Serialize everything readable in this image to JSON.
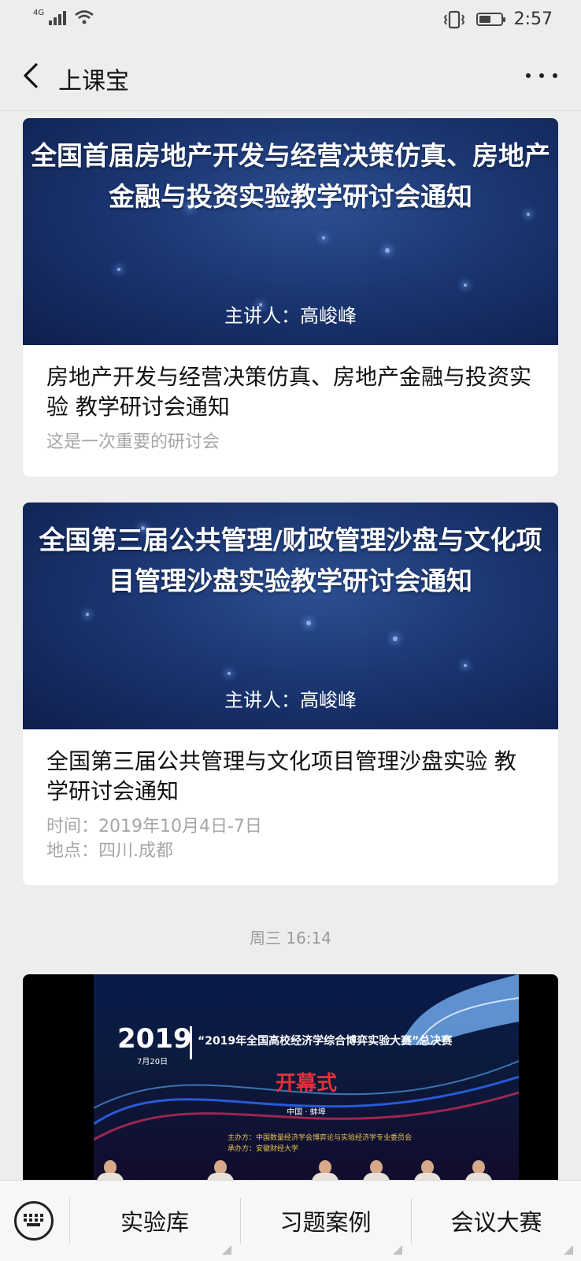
{
  "status_bar": {
    "network": "4G",
    "time": "2:57",
    "battery_level": 0.55
  },
  "nav": {
    "title": "上课宝"
  },
  "cards": [
    {
      "banner_title": "全国首届房地产开发与经营决策仿真、房地产金融与投资实验教学研讨会通知",
      "speaker": "主讲人：高峻峰",
      "title": "房地产开发与经营决策仿真、房地产金融与投资实验 教学研讨会通知",
      "desc_lines": [
        "这是一次重要的研讨会"
      ]
    },
    {
      "banner_title": "全国第三届公共管理/财政管理沙盘与文化项目管理沙盘实验教学研讨会通知",
      "speaker": "主讲人：高峻峰",
      "title": "全国第三届公共管理与文化项目管理沙盘实验 教学研讨会通知",
      "desc_lines": [
        "时间：2019年10月4日-7日",
        "地点：四川.成都"
      ]
    }
  ],
  "timestamp": "周三 16:14",
  "photo": {
    "year": "2019",
    "date": "7月20日",
    "headline": "“2019年全国高校经济学综合博弈实验大赛”总决赛",
    "opening": "开幕式",
    "city": "中国 · 蚌埠",
    "organizer": "主办方：中国数量经济学会博弈论与实验经济学专业委员会",
    "host": "承办方：安徽财经大学"
  },
  "bottom_menu": {
    "items": [
      {
        "label": "实验库"
      },
      {
        "label": "习题案例"
      },
      {
        "label": "会议大赛"
      }
    ]
  },
  "colors": {
    "background": "#ededed",
    "banner": "#1b3672",
    "muted_text": "#a6a6a6"
  }
}
